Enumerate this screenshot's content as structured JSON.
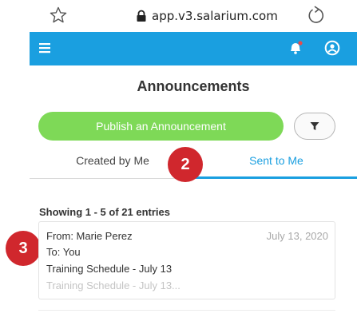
{
  "browser": {
    "url": "app.v3.salarium.com",
    "icons": {
      "bookmark": "star-icon",
      "lock": "lock-icon",
      "reload": "reload-icon"
    }
  },
  "header": {
    "color": "#1a9fe0",
    "icons": {
      "menu": "hamburger-menu-icon",
      "notifications": "bell-icon",
      "notification_dot_color": "#e64b4b",
      "profile": "user-icon"
    }
  },
  "page": {
    "title": "Announcements"
  },
  "actions": {
    "publish_label": "Publish an Announcement",
    "publish_color": "#7ed957",
    "filter_icon": "filter-icon"
  },
  "tabs": [
    {
      "label": "Created by Me",
      "active": false
    },
    {
      "label": "Sent to Me",
      "active": true
    }
  ],
  "callouts": [
    {
      "label": "2",
      "color": "#d0272d"
    },
    {
      "label": "3",
      "color": "#d0272d"
    }
  ],
  "list": {
    "summary": "Showing 1 - 5 of 21 entries",
    "items": [
      {
        "from": "From: Marie Perez",
        "date": "July 13, 2020",
        "to": "To: You",
        "subject": "Training Schedule - July 13",
        "preview": "Training Schedule - July 13..."
      }
    ]
  }
}
